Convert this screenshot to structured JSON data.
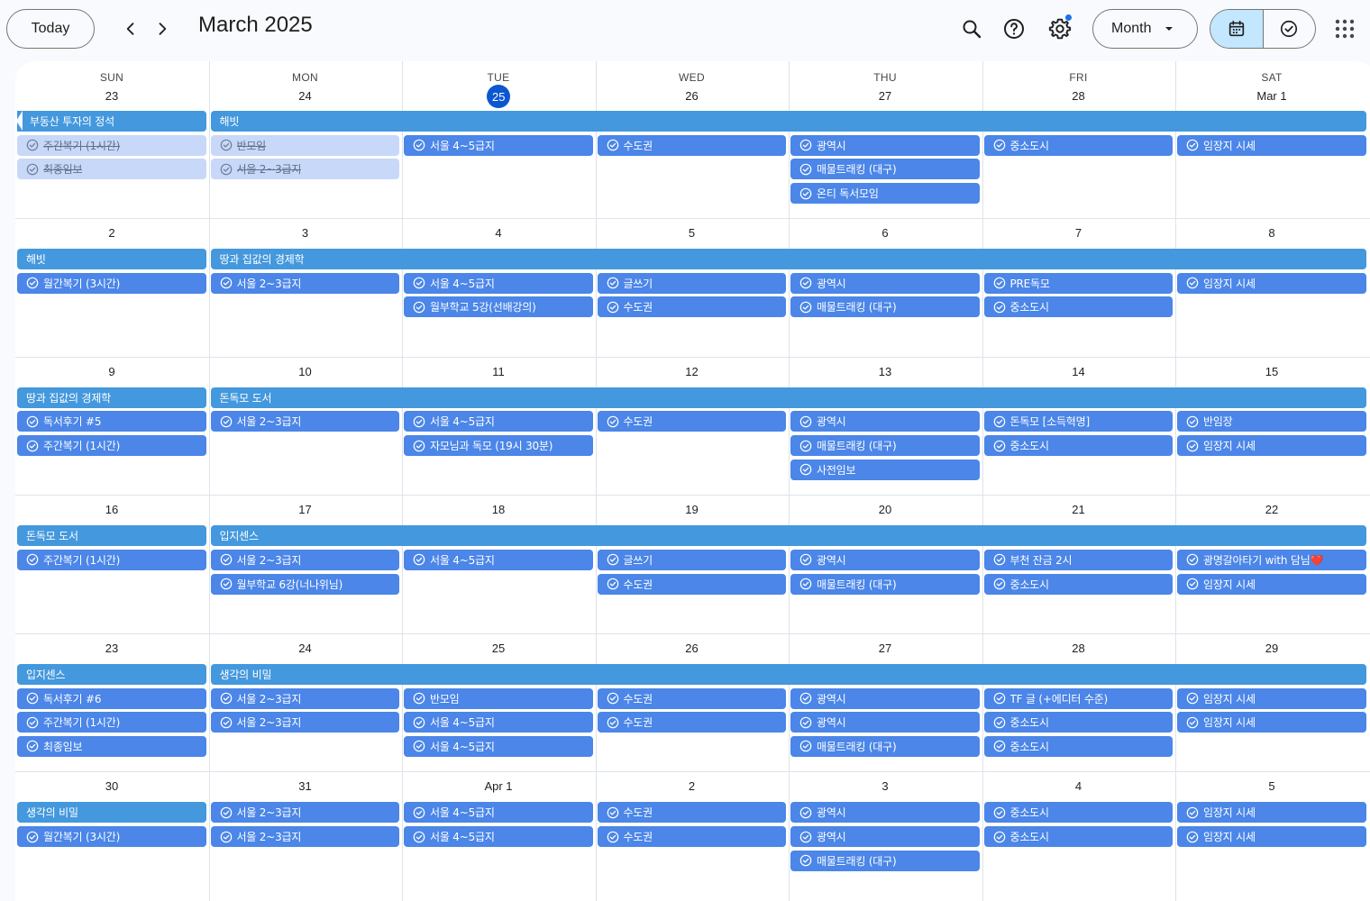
{
  "header": {
    "today_label": "Today",
    "title": "March 2025",
    "view_label": "Month",
    "icons": [
      "chevron-left-icon",
      "chevron-right-icon",
      "search-icon",
      "help-icon",
      "settings-icon",
      "calendar-icon",
      "task-check-icon",
      "apps-grid-icon",
      "caret-down-icon"
    ],
    "accent_color": "#0b57d0",
    "settings_badge": true
  },
  "colors": {
    "event_span": "#4498dd",
    "event_task": "#4b86e8",
    "event_completed": "#c8d8f8",
    "selected_view": "#c2e7ff"
  },
  "weekdays": [
    "SUN",
    "MON",
    "TUE",
    "WED",
    "THU",
    "FRI",
    "SAT"
  ],
  "weeks": [
    {
      "dates": [
        "23",
        "24",
        "25",
        "26",
        "27",
        "28",
        "Mar 1"
      ],
      "today_index": 2,
      "events": [
        {
          "day": 0,
          "span": 1,
          "row": 0,
          "kind": "span",
          "title": "부동산 투자의 정석",
          "continued": true
        },
        {
          "day": 1,
          "span": 6,
          "row": 0,
          "kind": "span",
          "title": "해빗"
        },
        {
          "day": 0,
          "span": 1,
          "row": 1,
          "kind": "task",
          "title": "주간복기 (1시간)",
          "done": true
        },
        {
          "day": 0,
          "span": 1,
          "row": 2,
          "kind": "task",
          "title": "최종임보",
          "done": true
        },
        {
          "day": 1,
          "span": 1,
          "row": 1,
          "kind": "task",
          "title": "반모임",
          "done": true
        },
        {
          "day": 1,
          "span": 1,
          "row": 2,
          "kind": "task",
          "title": "서울 2~3급지",
          "done": true
        },
        {
          "day": 2,
          "span": 1,
          "row": 1,
          "kind": "task",
          "title": "서울 4~5급지"
        },
        {
          "day": 3,
          "span": 1,
          "row": 1,
          "kind": "task",
          "title": "수도권"
        },
        {
          "day": 4,
          "span": 1,
          "row": 1,
          "kind": "task",
          "title": "광역시"
        },
        {
          "day": 4,
          "span": 1,
          "row": 2,
          "kind": "task",
          "title": "매물트래킹 (대구)"
        },
        {
          "day": 4,
          "span": 1,
          "row": 3,
          "kind": "task",
          "title": "온티 독서모임"
        },
        {
          "day": 5,
          "span": 1,
          "row": 1,
          "kind": "task",
          "title": "중소도시"
        },
        {
          "day": 6,
          "span": 1,
          "row": 1,
          "kind": "task",
          "title": "임장지 시세"
        }
      ]
    },
    {
      "dates": [
        "2",
        "3",
        "4",
        "5",
        "6",
        "7",
        "8"
      ],
      "events": [
        {
          "day": 0,
          "span": 1,
          "row": 0,
          "kind": "span",
          "title": "해빗"
        },
        {
          "day": 1,
          "span": 6,
          "row": 0,
          "kind": "span",
          "title": "땅과 집값의 경제학"
        },
        {
          "day": 0,
          "span": 1,
          "row": 1,
          "kind": "task",
          "title": "월간복기 (3시간)"
        },
        {
          "day": 1,
          "span": 1,
          "row": 1,
          "kind": "task",
          "title": "서울 2~3급지"
        },
        {
          "day": 2,
          "span": 1,
          "row": 1,
          "kind": "task",
          "title": "서울 4~5급지"
        },
        {
          "day": 2,
          "span": 1,
          "row": 2,
          "kind": "task",
          "title": "월부학교 5강(선배강의)"
        },
        {
          "day": 3,
          "span": 1,
          "row": 1,
          "kind": "task",
          "title": "글쓰기"
        },
        {
          "day": 3,
          "span": 1,
          "row": 2,
          "kind": "task",
          "title": "수도권"
        },
        {
          "day": 4,
          "span": 1,
          "row": 1,
          "kind": "task",
          "title": "광역시"
        },
        {
          "day": 4,
          "span": 1,
          "row": 2,
          "kind": "task",
          "title": "매물트래킹 (대구)"
        },
        {
          "day": 5,
          "span": 1,
          "row": 1,
          "kind": "task",
          "title": "PRE독모"
        },
        {
          "day": 5,
          "span": 1,
          "row": 2,
          "kind": "task",
          "title": "중소도시"
        },
        {
          "day": 6,
          "span": 1,
          "row": 1,
          "kind": "task",
          "title": "임장지 시세"
        }
      ]
    },
    {
      "dates": [
        "9",
        "10",
        "11",
        "12",
        "13",
        "14",
        "15"
      ],
      "events": [
        {
          "day": 0,
          "span": 1,
          "row": 0,
          "kind": "span",
          "title": "땅과 집값의 경제학"
        },
        {
          "day": 1,
          "span": 6,
          "row": 0,
          "kind": "span",
          "title": "돈독모 도서"
        },
        {
          "day": 0,
          "span": 1,
          "row": 1,
          "kind": "task",
          "title": "독서후기 #5"
        },
        {
          "day": 0,
          "span": 1,
          "row": 2,
          "kind": "task",
          "title": "주간복기 (1시간)"
        },
        {
          "day": 1,
          "span": 1,
          "row": 1,
          "kind": "task",
          "title": "서울 2~3급지"
        },
        {
          "day": 2,
          "span": 1,
          "row": 1,
          "kind": "task",
          "title": "서울 4~5급지"
        },
        {
          "day": 2,
          "span": 1,
          "row": 2,
          "kind": "task",
          "title": "자모님과 독모 (19시 30분)"
        },
        {
          "day": 3,
          "span": 1,
          "row": 1,
          "kind": "task",
          "title": "수도권"
        },
        {
          "day": 4,
          "span": 1,
          "row": 1,
          "kind": "task",
          "title": "광역시"
        },
        {
          "day": 4,
          "span": 1,
          "row": 2,
          "kind": "task",
          "title": "매물트래킹 (대구)"
        },
        {
          "day": 4,
          "span": 1,
          "row": 3,
          "kind": "task",
          "title": "사전임보"
        },
        {
          "day": 5,
          "span": 1,
          "row": 1,
          "kind": "task",
          "title": "돈독모 [소득혁명]"
        },
        {
          "day": 5,
          "span": 1,
          "row": 2,
          "kind": "task",
          "title": "중소도시"
        },
        {
          "day": 6,
          "span": 1,
          "row": 1,
          "kind": "task",
          "title": "반임장"
        },
        {
          "day": 6,
          "span": 1,
          "row": 2,
          "kind": "task",
          "title": "임장지 시세"
        }
      ]
    },
    {
      "dates": [
        "16",
        "17",
        "18",
        "19",
        "20",
        "21",
        "22"
      ],
      "events": [
        {
          "day": 0,
          "span": 1,
          "row": 0,
          "kind": "span",
          "title": "돈독모 도서"
        },
        {
          "day": 1,
          "span": 6,
          "row": 0,
          "kind": "span",
          "title": "입지센스"
        },
        {
          "day": 0,
          "span": 1,
          "row": 1,
          "kind": "task",
          "title": "주간복기 (1시간)"
        },
        {
          "day": 1,
          "span": 1,
          "row": 1,
          "kind": "task",
          "title": "서울 2~3급지"
        },
        {
          "day": 1,
          "span": 1,
          "row": 2,
          "kind": "task",
          "title": "월부학교 6강(너나위님)"
        },
        {
          "day": 2,
          "span": 1,
          "row": 1,
          "kind": "task",
          "title": "서울 4~5급지"
        },
        {
          "day": 3,
          "span": 1,
          "row": 1,
          "kind": "task",
          "title": "글쓰기"
        },
        {
          "day": 3,
          "span": 1,
          "row": 2,
          "kind": "task",
          "title": "수도권"
        },
        {
          "day": 4,
          "span": 1,
          "row": 1,
          "kind": "task",
          "title": "광역시"
        },
        {
          "day": 4,
          "span": 1,
          "row": 2,
          "kind": "task",
          "title": "매물트래킹 (대구)"
        },
        {
          "day": 5,
          "span": 1,
          "row": 1,
          "kind": "task",
          "title": "부천 잔금 2시"
        },
        {
          "day": 5,
          "span": 1,
          "row": 2,
          "kind": "task",
          "title": "중소도시"
        },
        {
          "day": 6,
          "span": 1,
          "row": 1,
          "kind": "task",
          "title": "광명갈아타기 with 담님❤️"
        },
        {
          "day": 6,
          "span": 1,
          "row": 2,
          "kind": "task",
          "title": "임장지 시세"
        }
      ]
    },
    {
      "dates": [
        "23",
        "24",
        "25",
        "26",
        "27",
        "28",
        "29"
      ],
      "events": [
        {
          "day": 0,
          "span": 1,
          "row": 0,
          "kind": "span",
          "title": "입지센스"
        },
        {
          "day": 1,
          "span": 6,
          "row": 0,
          "kind": "span",
          "title": "생각의 비밀"
        },
        {
          "day": 0,
          "span": 1,
          "row": 1,
          "kind": "task",
          "title": "독서후기 #6"
        },
        {
          "day": 0,
          "span": 1,
          "row": 2,
          "kind": "task",
          "title": "주간복기 (1시간)"
        },
        {
          "day": 0,
          "span": 1,
          "row": 3,
          "kind": "task",
          "title": "최종임보"
        },
        {
          "day": 1,
          "span": 1,
          "row": 1,
          "kind": "task",
          "title": "서울 2~3급지"
        },
        {
          "day": 1,
          "span": 1,
          "row": 2,
          "kind": "task",
          "title": "서울 2~3급지"
        },
        {
          "day": 2,
          "span": 1,
          "row": 1,
          "kind": "task",
          "title": "반모임"
        },
        {
          "day": 2,
          "span": 1,
          "row": 2,
          "kind": "task",
          "title": "서울 4~5급지"
        },
        {
          "day": 2,
          "span": 1,
          "row": 3,
          "kind": "task",
          "title": "서울 4~5급지"
        },
        {
          "day": 3,
          "span": 1,
          "row": 1,
          "kind": "task",
          "title": "수도권"
        },
        {
          "day": 3,
          "span": 1,
          "row": 2,
          "kind": "task",
          "title": "수도권"
        },
        {
          "day": 4,
          "span": 1,
          "row": 1,
          "kind": "task",
          "title": "광역시"
        },
        {
          "day": 4,
          "span": 1,
          "row": 2,
          "kind": "task",
          "title": "광역시"
        },
        {
          "day": 4,
          "span": 1,
          "row": 3,
          "kind": "task",
          "title": "매물트래킹 (대구)"
        },
        {
          "day": 5,
          "span": 1,
          "row": 1,
          "kind": "task",
          "title": "TF 글 (+에디터 수준)"
        },
        {
          "day": 5,
          "span": 1,
          "row": 2,
          "kind": "task",
          "title": "중소도시"
        },
        {
          "day": 5,
          "span": 1,
          "row": 3,
          "kind": "task",
          "title": "중소도시"
        },
        {
          "day": 6,
          "span": 1,
          "row": 1,
          "kind": "task",
          "title": "임장지 시세"
        },
        {
          "day": 6,
          "span": 1,
          "row": 2,
          "kind": "task",
          "title": "임장지 시세"
        }
      ]
    },
    {
      "dates": [
        "30",
        "31",
        "Apr 1",
        "2",
        "3",
        "4",
        "5"
      ],
      "events": [
        {
          "day": 0,
          "span": 1,
          "row": 0,
          "kind": "span",
          "title": "생각의 비밀"
        },
        {
          "day": 0,
          "span": 1,
          "row": 1,
          "kind": "task",
          "title": "월간복기 (3시간)"
        },
        {
          "day": 1,
          "span": 1,
          "row": 0,
          "kind": "task",
          "title": "서울 2~3급지"
        },
        {
          "day": 1,
          "span": 1,
          "row": 1,
          "kind": "task",
          "title": "서울 2~3급지"
        },
        {
          "day": 2,
          "span": 1,
          "row": 0,
          "kind": "task",
          "title": "서울 4~5급지"
        },
        {
          "day": 2,
          "span": 1,
          "row": 1,
          "kind": "task",
          "title": "서울 4~5급지"
        },
        {
          "day": 3,
          "span": 1,
          "row": 0,
          "kind": "task",
          "title": "수도권"
        },
        {
          "day": 3,
          "span": 1,
          "row": 1,
          "kind": "task",
          "title": "수도권"
        },
        {
          "day": 4,
          "span": 1,
          "row": 0,
          "kind": "task",
          "title": "광역시"
        },
        {
          "day": 4,
          "span": 1,
          "row": 1,
          "kind": "task",
          "title": "광역시"
        },
        {
          "day": 4,
          "span": 1,
          "row": 2,
          "kind": "task",
          "title": "매물트래킹 (대구)"
        },
        {
          "day": 5,
          "span": 1,
          "row": 0,
          "kind": "task",
          "title": "중소도시"
        },
        {
          "day": 5,
          "span": 1,
          "row": 1,
          "kind": "task",
          "title": "중소도시"
        },
        {
          "day": 6,
          "span": 1,
          "row": 0,
          "kind": "task",
          "title": "임장지 시세"
        },
        {
          "day": 6,
          "span": 1,
          "row": 1,
          "kind": "task",
          "title": "임장지 시세"
        }
      ]
    }
  ]
}
